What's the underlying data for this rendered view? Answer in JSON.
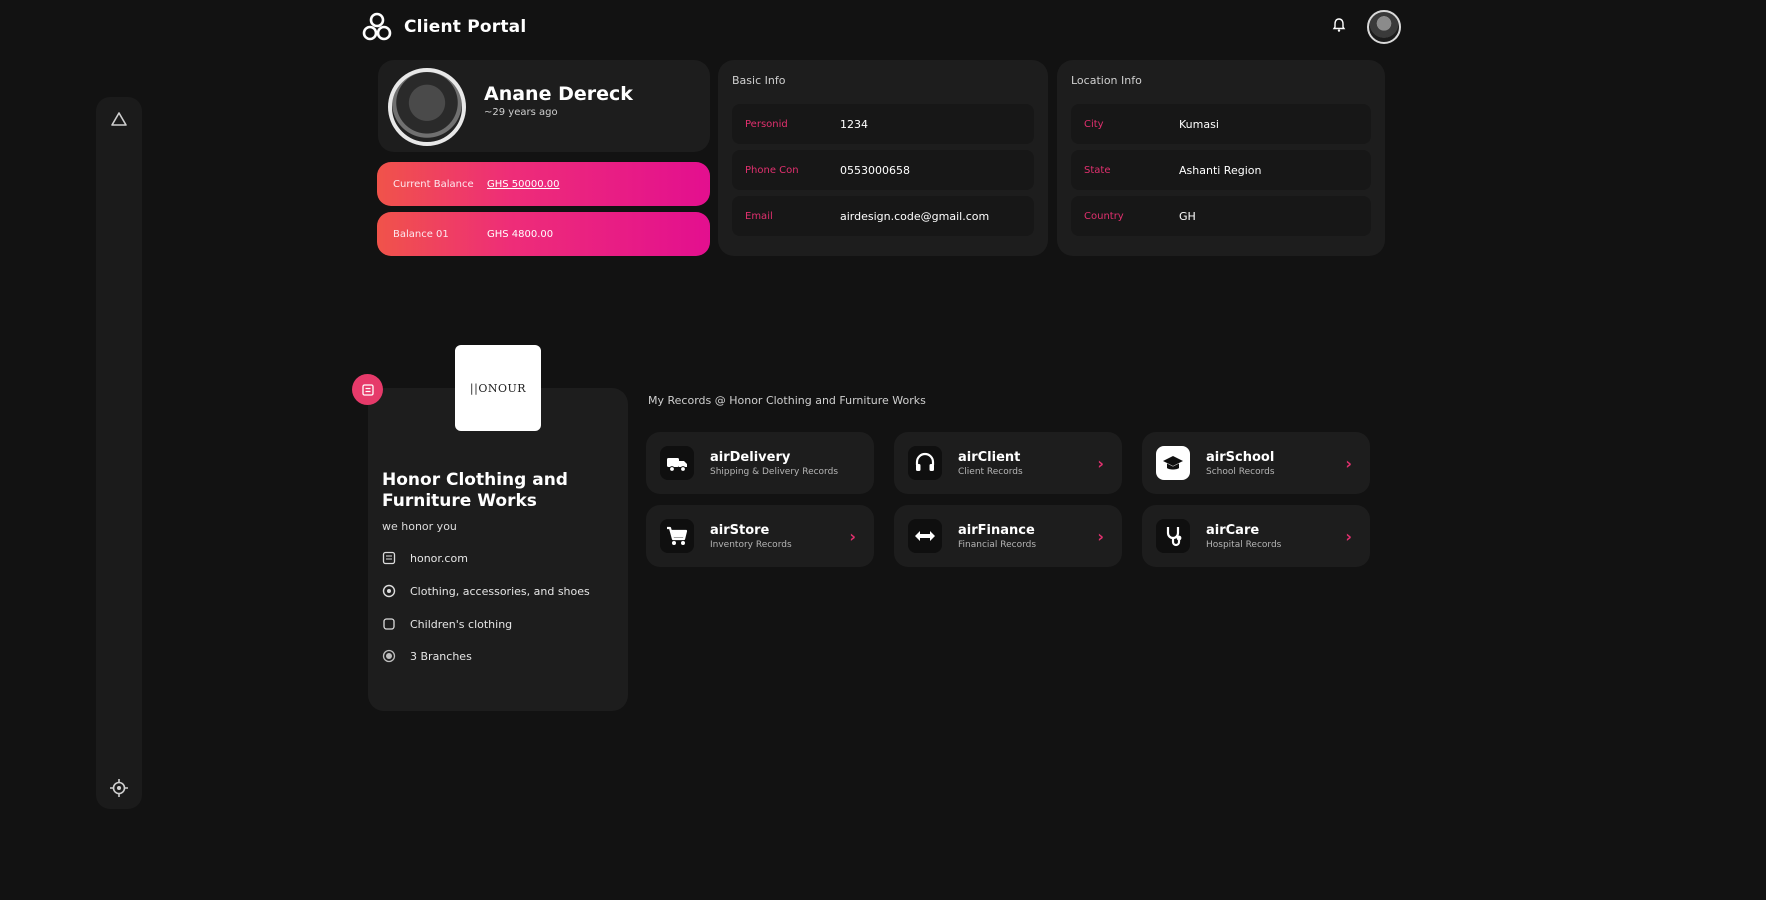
{
  "header": {
    "app_title": "Client Portal",
    "logo_icon": "tri-circle-logo-icon",
    "bell_icon": "bell-icon",
    "avatar_icon": "user-avatar-icon"
  },
  "sidebar": {
    "top_icon": "home-icon",
    "bottom_icon": "settings-icon"
  },
  "profile": {
    "name": "Anane Dereck",
    "age": "~29 years ago"
  },
  "balances": {
    "current_label": "Current Balance",
    "current_value": "GHS 50000.00",
    "other_label": "Balance 01",
    "other_value": "GHS 4800.00"
  },
  "basic_info": {
    "title": "Basic Info",
    "rows": [
      {
        "key": "Personid",
        "value": "1234"
      },
      {
        "key": "Phone Con",
        "value": "0553000658"
      },
      {
        "key": "Email",
        "value": "airdesign.code@gmail.com"
      }
    ]
  },
  "location_info": {
    "title": "Location Info",
    "rows": [
      {
        "key": "City",
        "value": "Kumasi"
      },
      {
        "key": "State",
        "value": "Ashanti Region"
      },
      {
        "key": "Country",
        "value": "GH"
      }
    ]
  },
  "business": {
    "logo_text": "||ONOUR",
    "name": "Honor Clothing and Furniture Works",
    "tagline": "we honor you",
    "items": [
      {
        "icon": "web-icon",
        "text": "honor.com"
      },
      {
        "icon": "shirt-icon",
        "text": "Clothing, accessories, and shoes"
      },
      {
        "icon": "child-icon",
        "text": "Children's clothing"
      },
      {
        "icon": "location-icon",
        "text": "3 Branches"
      }
    ],
    "menu_icon": "menu-icon"
  },
  "records": {
    "title": "My Records @ Honor Clothing and Furniture Works",
    "items": [
      {
        "name": "airDelivery",
        "sub": "Shipping & Delivery Records",
        "icon": "delivery-truck-icon"
      },
      {
        "name": "airClient",
        "sub": "Client Records",
        "icon": "headset-icon"
      },
      {
        "name": "airSchool",
        "sub": "School Records",
        "icon": "graduation-cap-icon"
      },
      {
        "name": "airStore",
        "sub": "Inventory Records",
        "icon": "shopping-cart-icon"
      },
      {
        "name": "airFinance",
        "sub": "Financial Records",
        "icon": "exchange-arrows-icon"
      },
      {
        "name": "airCare",
        "sub": "Hospital Records",
        "icon": "stethoscope-icon"
      }
    ],
    "arrow": "›"
  },
  "colors": {
    "accent": "#e0306e",
    "gradient_start": "#f0534a",
    "gradient_end": "#e30f8f",
    "background": "#121212",
    "card": "#1d1d1d"
  }
}
